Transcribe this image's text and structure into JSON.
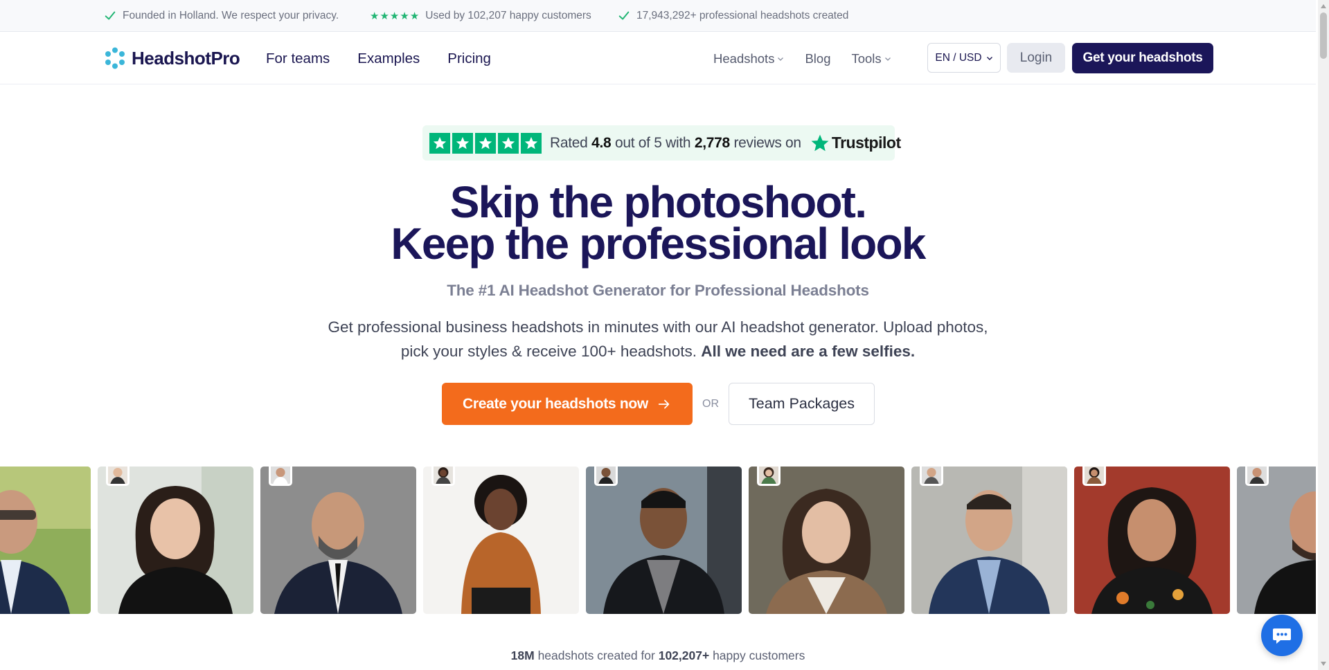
{
  "topbar": {
    "item1": "Founded in Holland. We respect your privacy.",
    "item2": "Used by 102,207 happy customers",
    "item3": "17,943,292+ professional headshots created"
  },
  "nav": {
    "logo": "HeadshotPro",
    "links": [
      "For teams",
      "Examples",
      "Pricing"
    ],
    "right_links": [
      "Headshots",
      "Blog",
      "Tools"
    ],
    "language": "EN / USD",
    "login": "Login",
    "cta": "Get your headshots"
  },
  "trustpilot": {
    "rated_prefix": "Rated",
    "rating": "4.8",
    "middle": "out of 5 with",
    "reviews": "2,778",
    "suffix": "reviews on",
    "brand": "Trustpilot"
  },
  "hero": {
    "title_line1": "Skip the photoshoot.",
    "title_line2": "Keep the professional look",
    "subtitle": "The #1 AI Headshot Generator for Professional Headshots",
    "description": "Get professional business headshots in minutes with our AI headshot generator. Upload photos, pick your styles & receive 100+ headshots.",
    "description_bold": "All we need are a few selfies.",
    "cta_primary": "Create your headshots now",
    "or": "OR",
    "cta_secondary": "Team Packages"
  },
  "stats": {
    "count1": "18M",
    "text1": "headshots created for",
    "count2": "102,207+",
    "text2": "happy customers"
  },
  "colors": {
    "brand_navy": "#1b1659",
    "cta_orange": "#f36b1c",
    "trustpilot_green": "#00b67a",
    "chat_blue": "#1f6fe5"
  }
}
